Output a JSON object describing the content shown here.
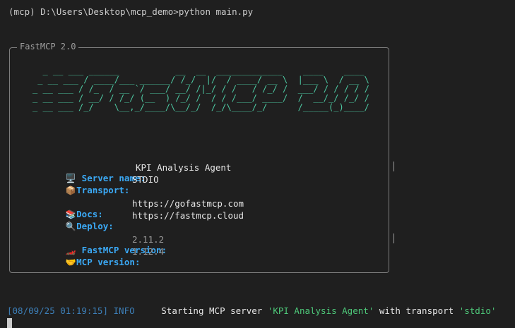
{
  "prompt": {
    "text": "(mcp) D:\\Users\\Desktop\\mcp_demo>python main.py"
  },
  "panel": {
    "title": "FastMCP 2.0",
    "ascii_art": "  _ __ ___ ______           __  __  _____________    ____    ____ \n _ __ ___ / ____/___ ______/ /_/  |/  / ____/ __ \\  |___ \\  / __ \\\n_ __ ___ / /_  / __ `/ ___/ __/ /|_/ / /   / /_/ /  ___/ / / / / /\n_ __ ___ / __/ / /_/ (__  ) /_/ /  / / /___/ ____/  /  __/_/ /_/ / \n_ __ ___ /_/    \\__,_/____/\\__/_/  /_/\\____/_/      /_____(_)____/  ",
    "rows": [
      {
        "icon": "🖥️",
        "icon_name": "computer-icon",
        "label": " Server name:",
        "value": "KPI Analysis Agent",
        "dim": false
      },
      {
        "icon": "📦",
        "icon_name": "package-icon",
        "label": "Transport:",
        "value": "STDIO",
        "dim": false
      },
      {
        "icon": "📚",
        "icon_name": "books-icon",
        "label": "Docs:",
        "value": "https://gofastmcp.com",
        "dim": false
      },
      {
        "icon": "🔍",
        "icon_name": "search-icon",
        "label": "Deploy:",
        "value": "https://fastmcp.cloud",
        "dim": false
      },
      {
        "icon": "🏎️",
        "icon_name": "race-car-icon",
        "label": " FastMCP version:",
        "value": "2.11.2",
        "dim": true
      },
      {
        "icon": "🤝",
        "icon_name": "handshake-icon",
        "label": "MCP version:",
        "value": "1.12.4",
        "dim": true
      }
    ]
  },
  "log": {
    "timestamp": "[08/09/25 01:19:15]",
    "level": "INFO",
    "message_prefix": "Starting MCP server ",
    "server_name": "'KPI Analysis Agent'",
    "message_middle": " with transport ",
    "transport": "'stdio'"
  },
  "colors": {
    "background": "#1f1f1f",
    "ascii_green": "#4ec9a3",
    "label_blue": "#3ba9f5",
    "log_blue": "#3d7fb8",
    "string_green": "#4ec97a"
  }
}
